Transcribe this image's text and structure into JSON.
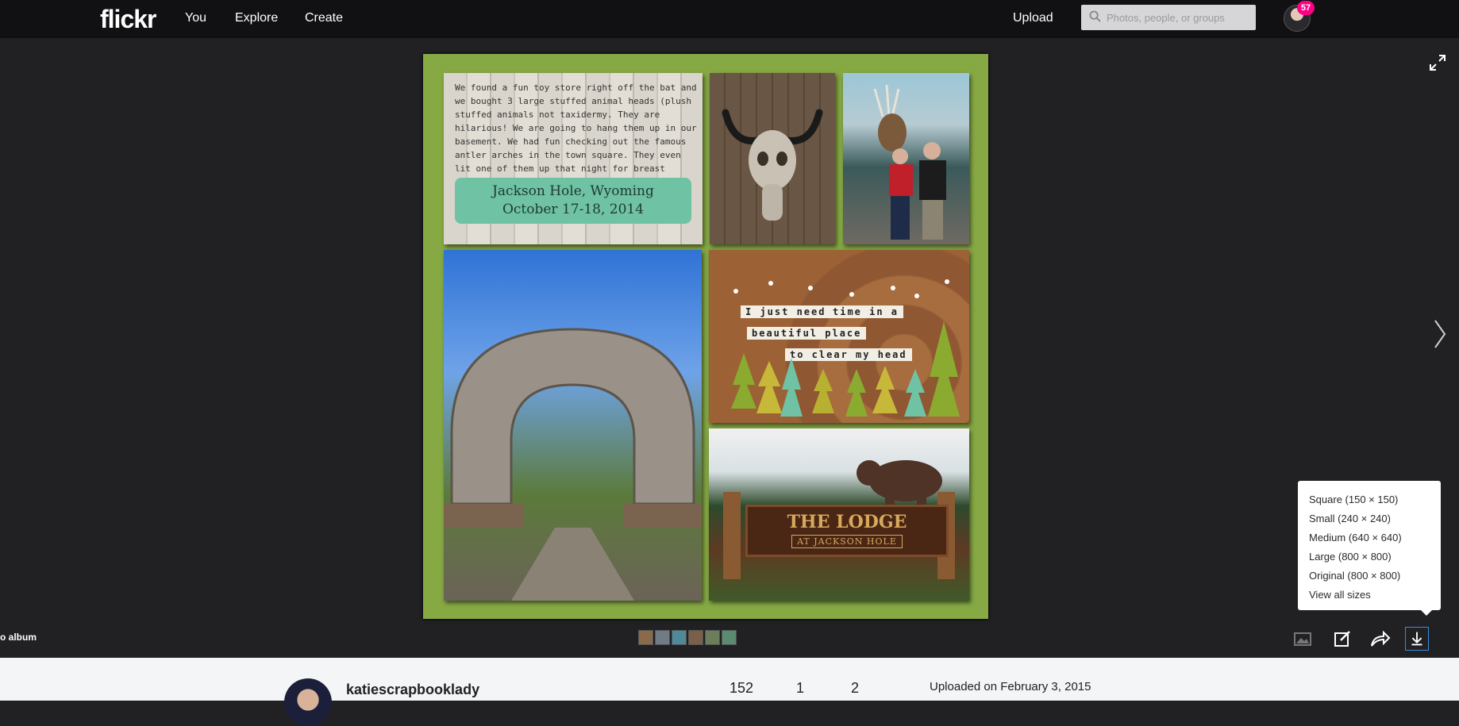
{
  "nav": {
    "logo": "flickr",
    "items": [
      "You",
      "Explore",
      "Create"
    ],
    "upload": "Upload",
    "search_placeholder": "Photos, people, or groups",
    "notification_count": "57"
  },
  "photo": {
    "story": "We found a fun toy store right off the bat and we bought 3 large stuffed animal heads (plush stuffed animals not taxidermy. They are hilarious! We are going to hang them up in our basement. We had fun checking out the famous antler arches in the town square. They even lit one of them up that night for breast cancer awareness.",
    "place": "Jackson Hole, Wyoming",
    "dates": "October 17-18, 2014",
    "quote_lines": [
      "I just need",
      "time in a",
      "beautiful place",
      "to clear my head"
    ],
    "sign_title": "THE LODGE",
    "sign_sub": "AT JACKSON HOLE"
  },
  "album_link": "o album",
  "thumb_colors": [
    "#8a6a4a",
    "#6f7c86",
    "#4f8a9a",
    "#7a6048",
    "#6c7d5a",
    "#5a8a70"
  ],
  "download_menu": {
    "items": [
      "Square (150 × 150)",
      "Small (240 × 240)",
      "Medium (640 × 640)",
      "Large (800 × 800)",
      "Original (800 × 800)",
      "View all sizes"
    ]
  },
  "owner": {
    "name": "katiescrapbooklady",
    "stats": [
      "152",
      "1",
      "2"
    ],
    "uploaded": "Uploaded on February 3, 2015"
  },
  "colors": {
    "background": "#212124",
    "topbar": "#111113",
    "mat": "#86a944",
    "badge": "#ff0084",
    "accent": "#3a8bd9"
  }
}
